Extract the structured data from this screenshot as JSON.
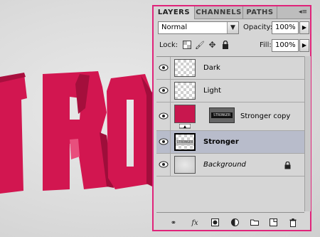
{
  "panel": {
    "tabs": [
      {
        "label": "LAYERS",
        "active": true
      },
      {
        "label": "CHANNELS",
        "active": false
      },
      {
        "label": "PATHS",
        "active": false
      }
    ],
    "menu_icon": "panel-menu-icon"
  },
  "blend_mode": {
    "value": "Normal"
  },
  "opacity": {
    "label": "Opacity:",
    "value": "100%"
  },
  "lock": {
    "label": "Lock:"
  },
  "fill": {
    "label": "Fill:",
    "value": "100%"
  },
  "layers": [
    {
      "name": "Dark",
      "selected": false
    },
    {
      "name": "Light",
      "selected": false
    },
    {
      "name": "Stronger copy",
      "selected": false,
      "thumb_color": "#c8174e"
    },
    {
      "name": "Stronger",
      "selected": true
    },
    {
      "name": "Background",
      "selected": false
    }
  ],
  "layer_thumb_text": "STRONGER",
  "colors": {
    "accent_border": "#e0247a",
    "text_red": "#d0134f"
  }
}
